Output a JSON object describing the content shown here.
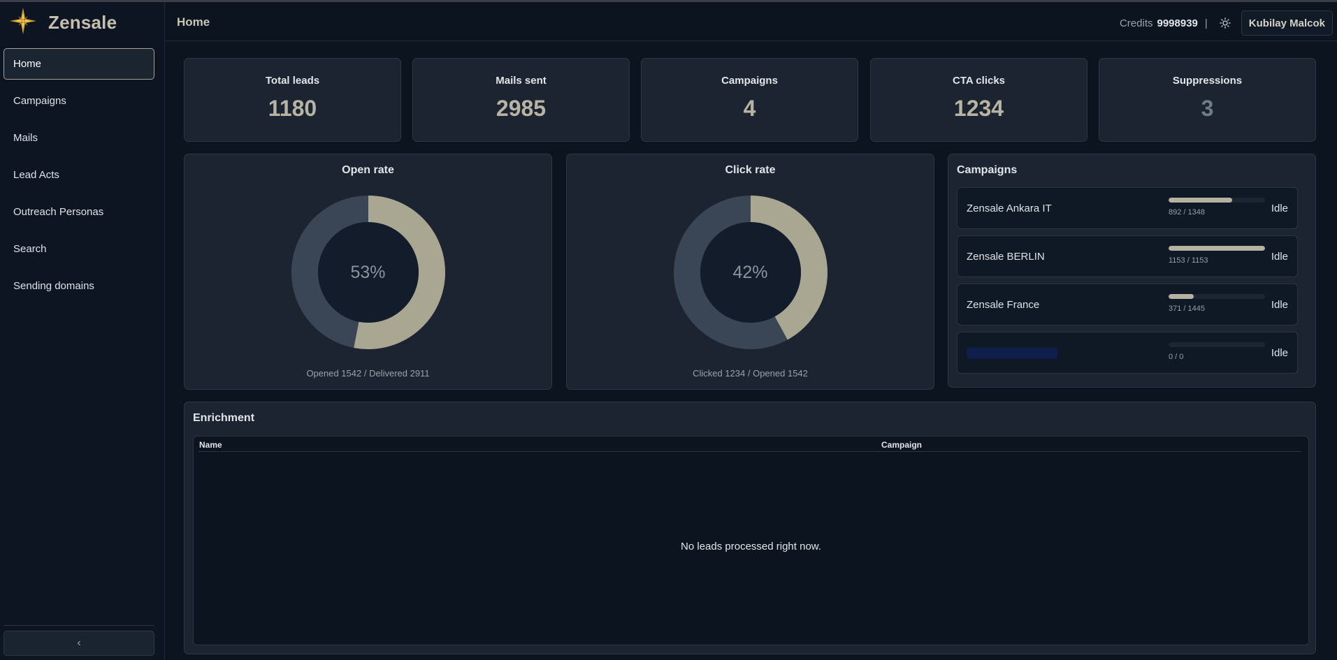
{
  "brand": {
    "name": "Zensale",
    "logo_icon": "compass-star-icon"
  },
  "sidebar": {
    "items": [
      {
        "label": "Home",
        "active": true
      },
      {
        "label": "Campaigns"
      },
      {
        "label": "Mails"
      },
      {
        "label": "Lead Acts"
      },
      {
        "label": "Outreach Personas"
      },
      {
        "label": "Search"
      },
      {
        "label": "Sending domains"
      }
    ],
    "collapse_icon": "chevron-left-icon",
    "collapse_glyph": "‹"
  },
  "header": {
    "title": "Home",
    "credits_label": "Credits",
    "credits_value": "9998939",
    "separator": "|",
    "theme_icon": "sun-icon",
    "user_name": "Kubilay Malcok"
  },
  "stats": [
    {
      "title": "Total leads",
      "value": "1180"
    },
    {
      "title": "Mails sent",
      "value": "2985"
    },
    {
      "title": "Campaigns",
      "value": "4"
    },
    {
      "title": "CTA clicks",
      "value": "1234"
    },
    {
      "title": "Suppressions",
      "value": "3"
    }
  ],
  "open_rate": {
    "title": "Open rate",
    "percent": 53,
    "center_label": "53%",
    "caption": "Opened 1542 / Delivered 2911"
  },
  "click_rate": {
    "title": "Click rate",
    "percent": 42,
    "center_label": "42%",
    "caption": "Clicked 1234 / Opened 1542"
  },
  "campaigns_panel": {
    "title": "Campaigns",
    "items": [
      {
        "name": "Zensale Ankara IT",
        "progress": 0.66,
        "count": "892 / 1348",
        "status": "Idle"
      },
      {
        "name": "Zensale BERLIN",
        "progress": 1.0,
        "count": "1153 / 1153",
        "status": "Idle"
      },
      {
        "name": "Zensale France",
        "progress": 0.26,
        "count": "371 / 1445",
        "status": "Idle"
      },
      {
        "name": "",
        "progress": 0,
        "count": "0 / 0",
        "status": "Idle"
      }
    ]
  },
  "enrichment": {
    "title": "Enrichment",
    "columns": [
      "Name",
      "Campaign"
    ],
    "empty_message": "No leads processed right now."
  },
  "colors": {
    "accent": "#b5b2a1",
    "donut_track": "#3a4656",
    "donut_fill": "#a9a691",
    "background": "#0c1420",
    "card": "#1b2430"
  }
}
